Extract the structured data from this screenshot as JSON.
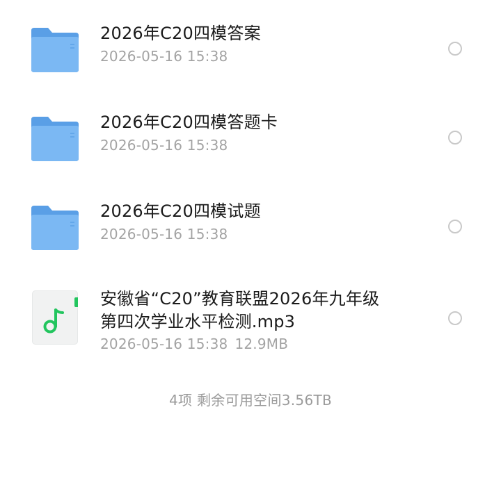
{
  "files": [
    {
      "name": "2026年C20四模答案",
      "date": "2026-05-16 15:38",
      "size": "",
      "icon": "folder-icon"
    },
    {
      "name": "2026年C20四模答题卡",
      "date": "2026-05-16 15:38",
      "size": "",
      "icon": "folder-icon"
    },
    {
      "name": "2026年C20四模试题",
      "date": "2026-05-16 15:38",
      "size": "",
      "icon": "folder-icon"
    },
    {
      "name": "安徽省“C20”教育联盟2026年九年级\n第四次学业水平检测.mp3",
      "date": "2026-05-16 15:38",
      "size": "12.9MB",
      "icon": "audio-file-icon"
    }
  ],
  "footer": {
    "summary": "4项  剩余可用空间3.56TB"
  },
  "colors": {
    "folder": "#6aaef0",
    "folder_back": "#5a9fe6",
    "audio_accent": "#22c55e"
  }
}
